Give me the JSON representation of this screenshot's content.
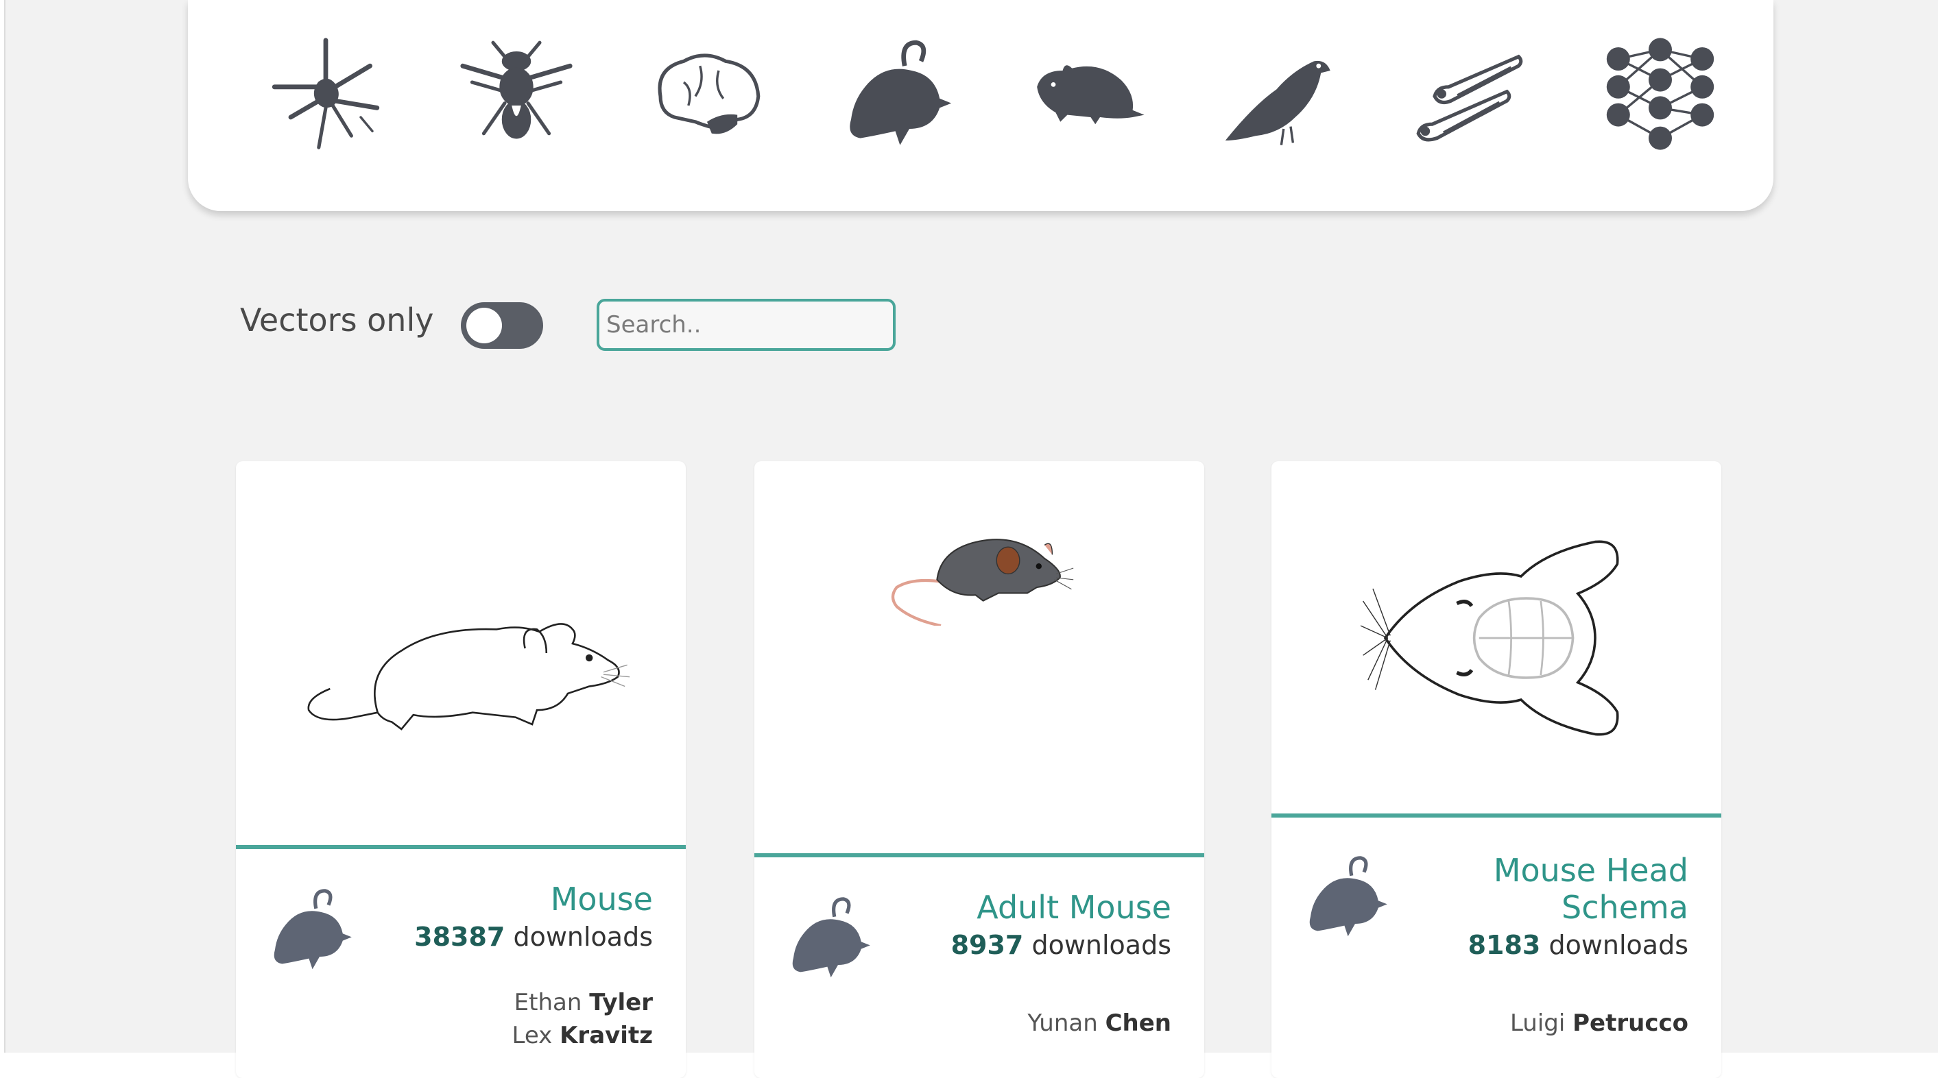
{
  "categories": [
    {
      "name": "neuron-icon"
    },
    {
      "name": "fly-icon"
    },
    {
      "name": "brain-icon"
    },
    {
      "name": "mouse-icon"
    },
    {
      "name": "rat-icon"
    },
    {
      "name": "bird-icon"
    },
    {
      "name": "zebrafish-icon"
    },
    {
      "name": "neural-network-icon"
    }
  ],
  "filters": {
    "vectors_only_label": "Vectors only",
    "vectors_only_enabled": false,
    "search_placeholder": "Search.."
  },
  "cards": [
    {
      "title": "Mouse",
      "downloads": "38387",
      "downloads_label": "downloads",
      "authors": [
        {
          "first": "Ethan",
          "last": "Tyler"
        },
        {
          "first": "Lex",
          "last": "Kravitz"
        }
      ],
      "category_icon": "mouse-icon"
    },
    {
      "title": "Adult Mouse",
      "downloads": "8937",
      "downloads_label": "downloads",
      "authors": [
        {
          "first": "Yunan",
          "last": "Chen"
        }
      ],
      "category_icon": "mouse-icon"
    },
    {
      "title_line1": "Mouse Head",
      "title_line2": "Schema",
      "downloads": "8183",
      "downloads_label": "downloads",
      "authors": [
        {
          "first": "Luigi",
          "last": "Petrucco"
        }
      ],
      "category_icon": "mouse-icon"
    }
  ],
  "colors": {
    "accent": "#4aa69a",
    "icon": "#4a4d55",
    "card_icon": "#5e6574",
    "background": "#f2f2f2"
  }
}
